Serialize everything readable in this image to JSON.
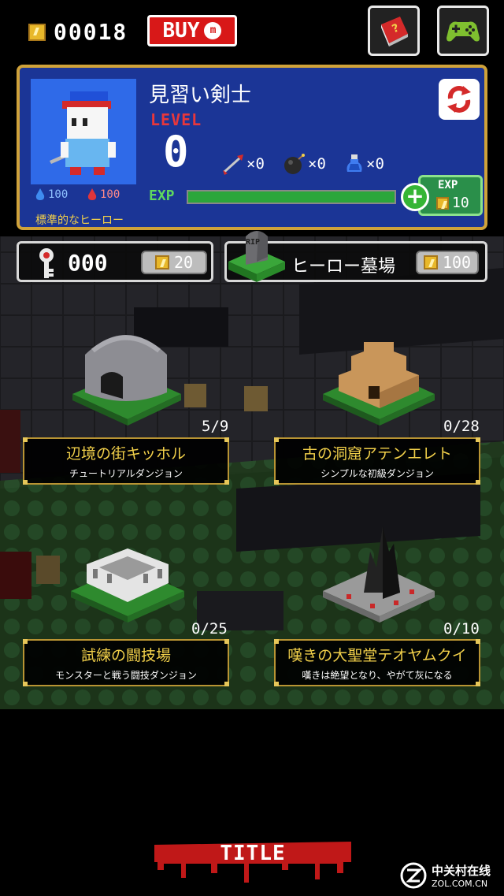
{
  "topbar": {
    "coin_count": "00018",
    "buy_label": "BUY",
    "buy_icon": "m-coin-icon",
    "book_icon": "book-help-icon",
    "gamepad_icon": "gamepad-icon"
  },
  "hero": {
    "name": "見習い剣士",
    "level_label": "LEVEL",
    "level": "0",
    "items": [
      {
        "icon": "arrow-icon",
        "count": "×0"
      },
      {
        "icon": "bomb-icon",
        "count": "×0"
      },
      {
        "icon": "potion-icon",
        "count": "×0"
      }
    ],
    "exp_label": "EXP",
    "exp_progress": 1.0,
    "exp_buy_label": "EXP",
    "exp_buy_cost": "10",
    "mp": "100",
    "hp": "100",
    "class_label": "標準的なヒーロー"
  },
  "keys": {
    "count": "000",
    "price": "20"
  },
  "graveyard": {
    "label": "ヒーロー墓場",
    "price": "100",
    "stone_text": "RIP"
  },
  "dungeons": [
    {
      "title": "辺境の街キッホル",
      "subtitle": "チュートリアルダンジョン",
      "progress": "5/9"
    },
    {
      "title": "古の洞窟アテンエレト",
      "subtitle": "シンプルな初級ダンジョン",
      "progress": "0/28"
    },
    {
      "title": "試練の闘技場",
      "subtitle": "モンスターと戦う闘技ダンジョン",
      "progress": "0/25"
    },
    {
      "title": "嘆きの大聖堂テオヤムクイ",
      "subtitle": "嘆きは絶望となり、やがて灰になる",
      "progress": "0/10"
    }
  ],
  "title_button": "TITLE",
  "watermark": {
    "cn": "中关村在线",
    "en": "ZOL.COM.CN"
  },
  "colors": {
    "panel_blue": "#1b3596",
    "panel_border": "#cfa23a",
    "buy_red": "#d81818",
    "card_title_yellow": "#f2d04a",
    "exp_green": "#2ba63b"
  }
}
